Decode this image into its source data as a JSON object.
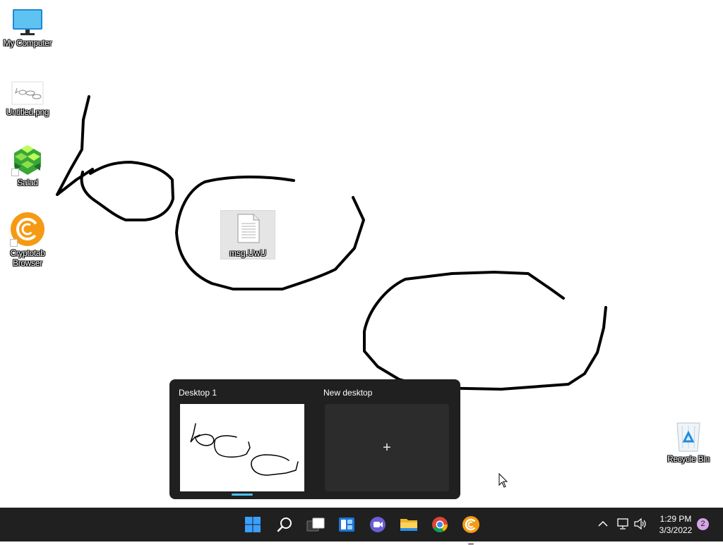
{
  "desktop": {
    "icons": {
      "my_computer": "My Computer",
      "untitled_png": "Untitled.png",
      "salad": "Salad",
      "cryptotab": "Cryptotab Browser",
      "msg_file": "msg.UwU",
      "recycle_bin": "Recycle Bin"
    }
  },
  "task_view": {
    "desktop1_label": "Desktop 1",
    "new_desktop_label": "New desktop",
    "plus": "+"
  },
  "taskbar": {
    "apps": [
      "start-icon",
      "search-icon",
      "task-view-icon",
      "widgets-icon",
      "chat-icon",
      "file-explorer-icon",
      "chrome-icon",
      "cryptotab-icon"
    ],
    "time": "1:29 PM",
    "date": "3/3/2022",
    "notification_count": "2"
  },
  "colors": {
    "taskbar": "#202020",
    "accent": "#4cc2ff",
    "badge": "#d6a5e6"
  }
}
